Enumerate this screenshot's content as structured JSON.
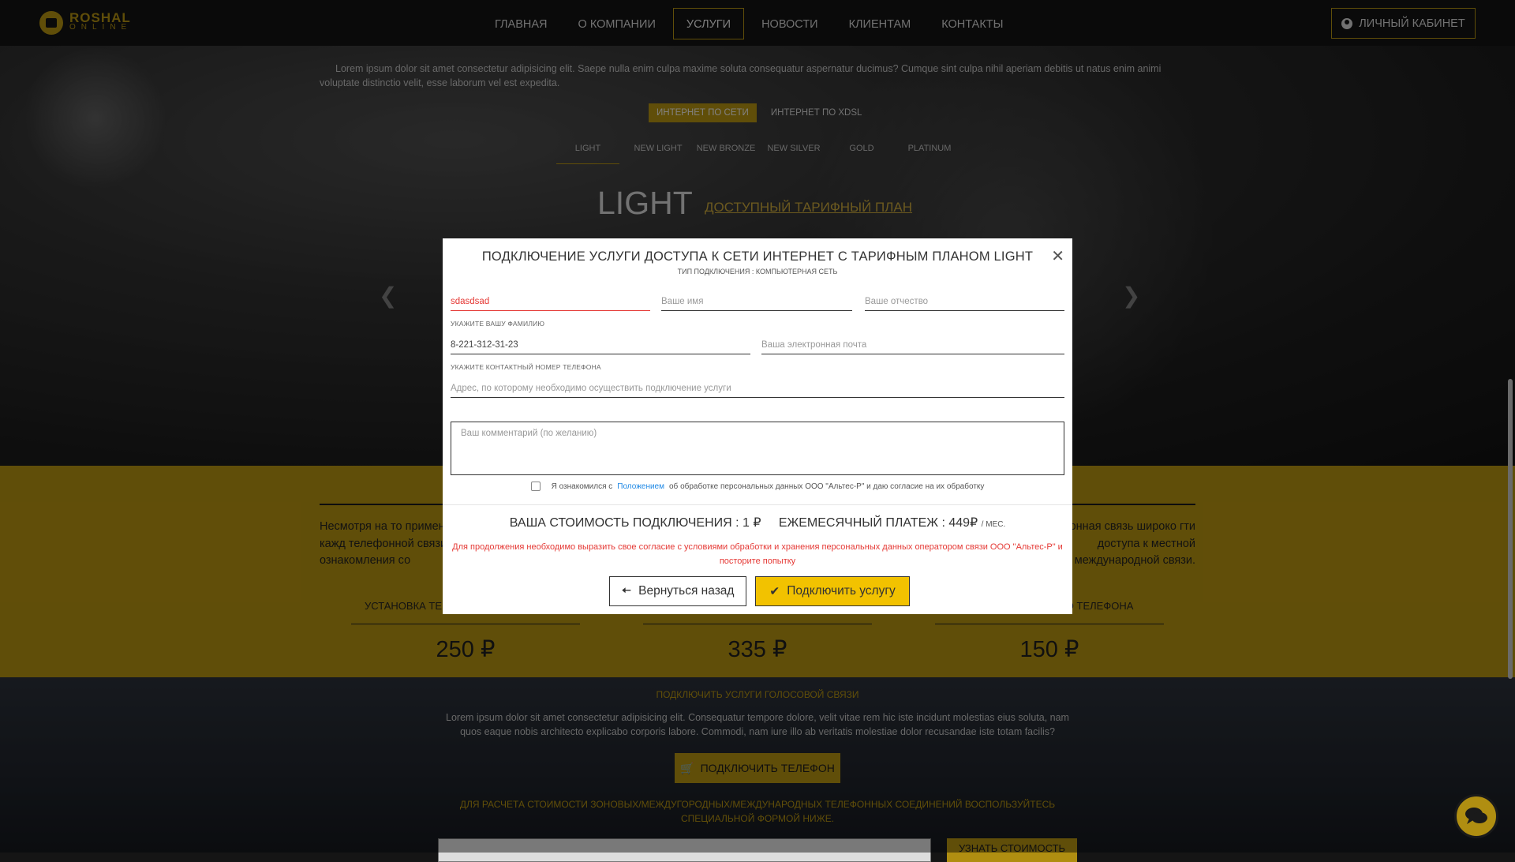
{
  "header": {
    "logo_name": "ROSHAL",
    "logo_sub": "ONLINE",
    "nav": [
      "ГЛАВНАЯ",
      "О КОМПАНИИ",
      "УСЛУГИ",
      "НОВОСТИ",
      "КЛИЕНТАМ",
      "КОНТАКТЫ"
    ],
    "active_nav": "УСЛУГИ",
    "cabinet_label": "ЛИЧНЫЙ КАБИНЕТ"
  },
  "hero": {
    "lorem": "Lorem ipsum dolor sit amet consectetur adipisicing elit. Saepe nulla enim culpa maxime soluta consequatur aspernatur ducimus? Cumque sint culpa nihil aperiam debitis ut natus enim animi voluptate distinctio velit, esse laborum vel est expedita.",
    "type_tabs": [
      "ИНТЕРНЕТ ПО СЕТИ",
      "ИНТЕРНЕТ ПО XDSL"
    ],
    "plan_tabs": [
      "LIGHT",
      "NEW LIGHT",
      "NEW BRONZE",
      "NEW SILVER",
      "GOLD",
      "PLATINUM"
    ],
    "plan_title": "LIGHT",
    "plan_subtitle": "ДОСТУПНЫЙ ТАРИФНЫЙ ПЛАН"
  },
  "phone_section": {
    "left_text": "Несмотря на то применяется в кажд телефонной связи. По Для ознакомления со",
    "right_text": "фонная связь широко гти доступа к местной международной связи.",
    "col_labels": [
      "УСТАНОВКА ТЕ",
      "",
      "НОГО ТЕЛЕФОНА"
    ],
    "prices": [
      "250 ₽",
      "335 ₽",
      "150 ₽"
    ]
  },
  "voice": {
    "title": "ПОДКЛЮЧИТЬ УСЛУГИ ГОЛОСОВОЙ СВЯЗИ",
    "text": "Lorem ipsum dolor sit amet consectetur adipisicing elit. Consequatur tempore dolore, velit vitae rem hic iste incidunt molestias eius soluta, nam quos eaque nobis architecto explicabo corporis labore. Commodi, nam iure illo ab veritatis molestiae dolor recusandae iste totam facilis?",
    "phone_button": "ПОДКЛЮЧИТЬ ТЕЛЕФОН",
    "calc_text": "ДЛЯ РАСЧЕТА СТОИМОСТИ ЗОНОВЫХ/МЕЖДУГОРОДНЫХ/МЕЖДУНАРОДНЫХ ТЕЛЕФОННЫХ СОЕДИНЕНИЙ ВОСПОЛЬЗУЙТЕСЬ СПЕЦИАЛЬНОЙ ФОРМОЙ НИЖЕ.",
    "calc_button": "УЗНАТЬ СТОИМОСТЬ"
  },
  "modal": {
    "title": "ПОДКЛЮЧЕНИЕ УСЛУГИ ДОСТУПА К СЕТИ ИНТЕРНЕТ С ТАРИФНЫМ ПЛАНОМ LIGHT",
    "subtitle": "ТИП ПОДКЛЮЧЕНИЯ : КОМПЬЮТЕРНАЯ СЕТЬ",
    "surname_value": "sdasdsad",
    "name_placeholder": "Ваше имя",
    "patronymic_placeholder": "Ваше отчество",
    "surname_hint": "УКАЖИТЕ ВАШУ ФАМИЛИЮ",
    "phone_value": "8-221-312-31-23",
    "email_placeholder": "Ваша электронная почта",
    "phone_hint": "УКАЖИТЕ КОНТАКТНЫЙ НОМЕР ТЕЛЕФОНА",
    "address_placeholder": "Адрес, по которому необходимо осуществить подключение услуги",
    "comment_placeholder": "Ваш комментарий (по желанию)",
    "agree_pre": "Я ознакомился с",
    "agree_link": "Положением",
    "agree_post": "об обработке персональных данных ООО \"Альтес-Р\" и даю согласие на их обработку",
    "cost_connect": "ВАША СТОИМОСТЬ ПОДКЛЮЧЕНИЯ : 1 ₽",
    "cost_monthly": "ЕЖЕМЕСЯЧНЫЙ ПЛАТЕЖ : 449₽",
    "cost_unit": "/ МЕС.",
    "error_text": "Для продолжения необходимо выразить свое согласие с условиями обработки и хранения персональных данных оператором связи ООО \"Альтес-Р\" и посторите попытку",
    "back_button": "Вернуться назад",
    "connect_button": "Подключить услугу"
  },
  "colors": {
    "accent": "#b08e11",
    "error": "#e53935",
    "button_yellow": "#f2c200"
  }
}
